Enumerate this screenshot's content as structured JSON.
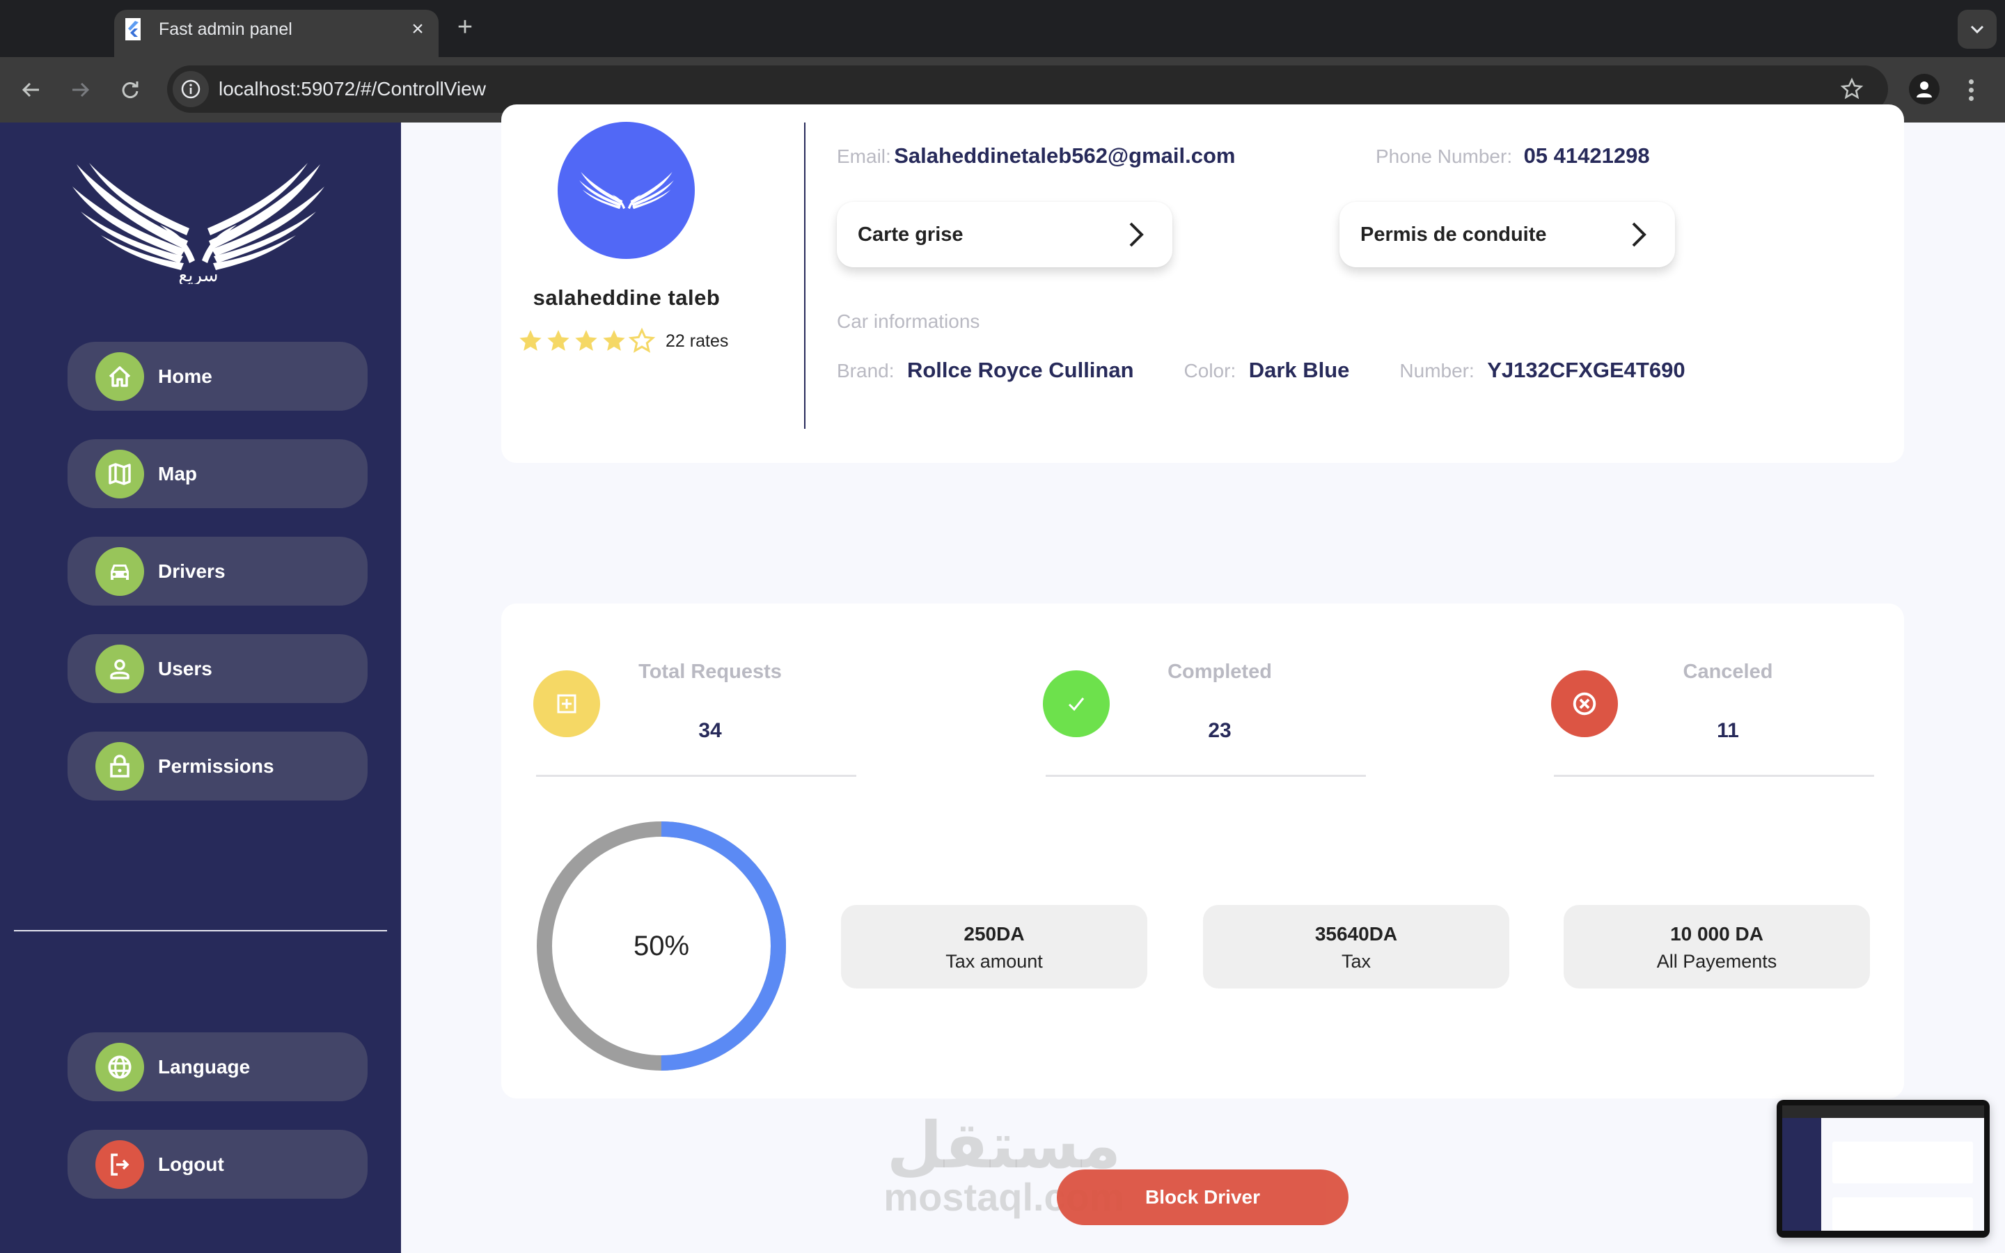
{
  "browser": {
    "tab_title": "Fast admin panel",
    "url": "localhost:59072/#/ControllView",
    "icons": {
      "favicon": "flutter-logo-icon",
      "close": "close-icon",
      "new_tab": "plus-icon",
      "tab_search": "chevron-down-icon",
      "back": "arrow-left-icon",
      "forward": "arrow-right-icon",
      "reload": "reload-icon",
      "site_info": "info-icon",
      "bookmark": "star-outline-icon",
      "profile": "person-icon",
      "menu": "kebab-menu-icon"
    }
  },
  "sidebar": {
    "logo_text": "سريع",
    "items": [
      {
        "label": "Home",
        "icon": "home-icon"
      },
      {
        "label": "Map",
        "icon": "map-icon"
      },
      {
        "label": "Drivers",
        "icon": "car-icon"
      },
      {
        "label": "Users",
        "icon": "user-icon"
      },
      {
        "label": "Permissions",
        "icon": "lock-icon"
      }
    ],
    "bottom_items": [
      {
        "label": "Language",
        "icon": "globe-icon"
      },
      {
        "label": "Logout",
        "icon": "logout-icon"
      }
    ]
  },
  "profile": {
    "name": "salaheddine taleb",
    "rating": 4,
    "rating_max": 5,
    "rates_count": "22",
    "rates_label": "rates",
    "email_label": "Email:",
    "email": "Salaheddinetaleb562@gmail.com",
    "phone_label": "Phone Number:",
    "phone": "05 41421298",
    "documents": [
      {
        "label": "Carte grise"
      },
      {
        "label": "Permis de conduite"
      }
    ],
    "car_info_title": "Car informations",
    "car": {
      "brand_label": "Brand:",
      "brand": "Rollce Royce Cullinan",
      "color_label": "Color:",
      "color": "Dark Blue",
      "number_label": "Number:",
      "number": "YJ132CFXGE4T690"
    }
  },
  "stats": {
    "items": [
      {
        "title": "Total Requests",
        "value": "34",
        "icon": "add-box-icon",
        "color": "#F5D865"
      },
      {
        "title": "Completed",
        "value": "23",
        "icon": "check-icon",
        "color": "#6DE14C"
      },
      {
        "title": "Canceled",
        "value": "11",
        "icon": "cancel-icon",
        "color": "#DC5544"
      }
    ],
    "progress": {
      "percent": 50,
      "label": "50%",
      "fill_color": "#5B8AF4",
      "track_color": "#9E9E9E"
    },
    "money": [
      {
        "value": "250DA",
        "label": "Tax amount"
      },
      {
        "value": "35640DA",
        "label": "Tax"
      },
      {
        "value": "10 000 DA",
        "label": "All Payements"
      }
    ]
  },
  "actions": {
    "block_driver": "Block Driver"
  },
  "watermark": {
    "arabic": "مستقل",
    "latin": "mostaql.com"
  },
  "colors": {
    "sidebar_bg": "#272A5A",
    "sidebar_item_bg": "#434568",
    "icon_green": "#98C55A",
    "danger": "#DC5544",
    "avatar_bg": "#5168F6",
    "page_bg": "#F7F8FD"
  }
}
